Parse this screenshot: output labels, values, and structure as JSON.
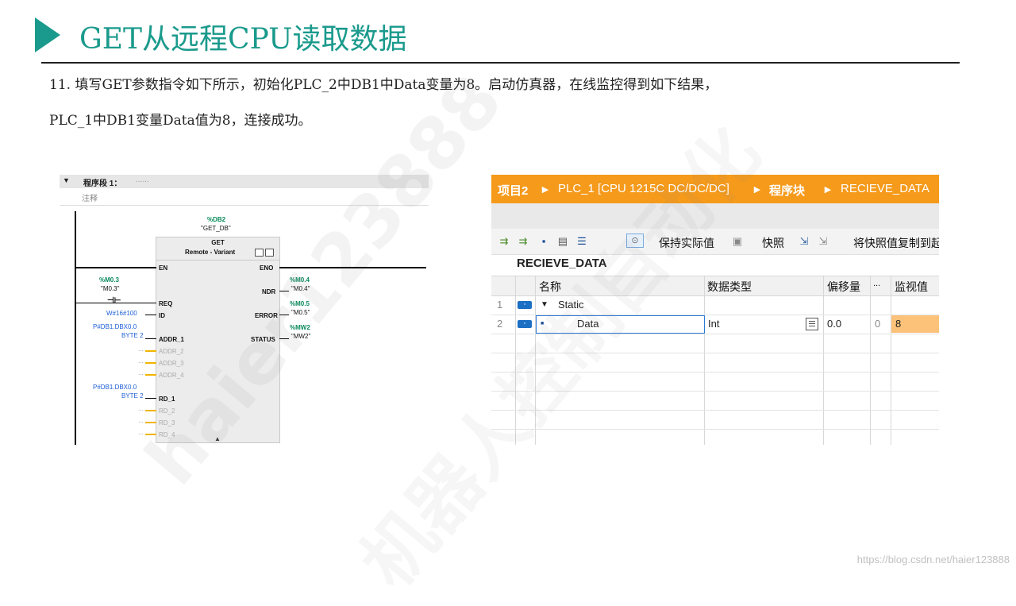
{
  "slide": {
    "title": "GET从远程CPU读取数据",
    "description_line1": "11. 填写GET参数指令如下所示，初始化PLC_2中DB1中Data变量为8。启动仿真器，在线监控得到如下结果，",
    "description_line2": "PLC_1中DB1变量Data值为8，连接成功。",
    "watermark_url": "https://blog.csdn.net/haier123888",
    "watermark_a": "haier123888",
    "watermark_b": "机器人控制自动化",
    "accent_color": "#1a9a8c"
  },
  "ladder": {
    "segment_label": "程序段 1：",
    "segment_dots": "......",
    "comment": "注释",
    "db_address": "%DB2",
    "db_symbol": "\"GET_DB\"",
    "block_name": "GET",
    "block_subtitle": "Remote - Variant",
    "pins_left": {
      "en": "EN",
      "req": "REQ",
      "id": "ID",
      "addr1": "ADDR_1",
      "addr2": "ADDR_2",
      "addr3": "ADDR_3",
      "addr4": "ADDR_4",
      "rd1": "RD_1",
      "rd2": "RD_2",
      "rd3": "RD_3",
      "rd4": "RD_4"
    },
    "pins_right": {
      "eno": "ENO",
      "ndr": "NDR",
      "error": "ERROR",
      "status": "STATUS"
    },
    "req_tag_addr": "%M0.3",
    "req_tag_sym": "\"M0.3\"",
    "id_value": "W#16#100",
    "addr1_value_a": "P#DB1.DBX0.0",
    "addr1_value_b": "BYTE 2",
    "rd1_value_a": "P#DB1.DBX0.0",
    "rd1_value_b": "BYTE 2",
    "ndr_addr": "%M0.4",
    "ndr_sym": "\"M0.4\"",
    "error_addr": "%M0.5",
    "error_sym": "\"M0.5\"",
    "status_addr": "%MW2",
    "status_sym": "\"MW2\"",
    "ellipsis": "..."
  },
  "db_editor": {
    "breadcrumb": [
      "项目2",
      "PLC_1 [CPU 1215C DC/DC/DC]",
      "程序块",
      "RECIEVE_DATA"
    ],
    "toolbar": {
      "keep_actual": "保持实际值",
      "snapshot": "快照",
      "copy_snapshot": "将快照值复制到起"
    },
    "db_name": "RECIEVE_DATA",
    "columns": [
      "名称",
      "数据类型",
      "偏移量",
      "...",
      "监视值"
    ],
    "rows": [
      {
        "num": "1",
        "name": "Static",
        "type": "",
        "offset": "",
        "retain": "",
        "monitor": ""
      },
      {
        "num": "2",
        "name": "Data",
        "type": "Int",
        "offset": "0.0",
        "retain": "0",
        "monitor": "8"
      }
    ],
    "monitor_color": "#fcc27a",
    "header_color": "#f59a1b"
  }
}
